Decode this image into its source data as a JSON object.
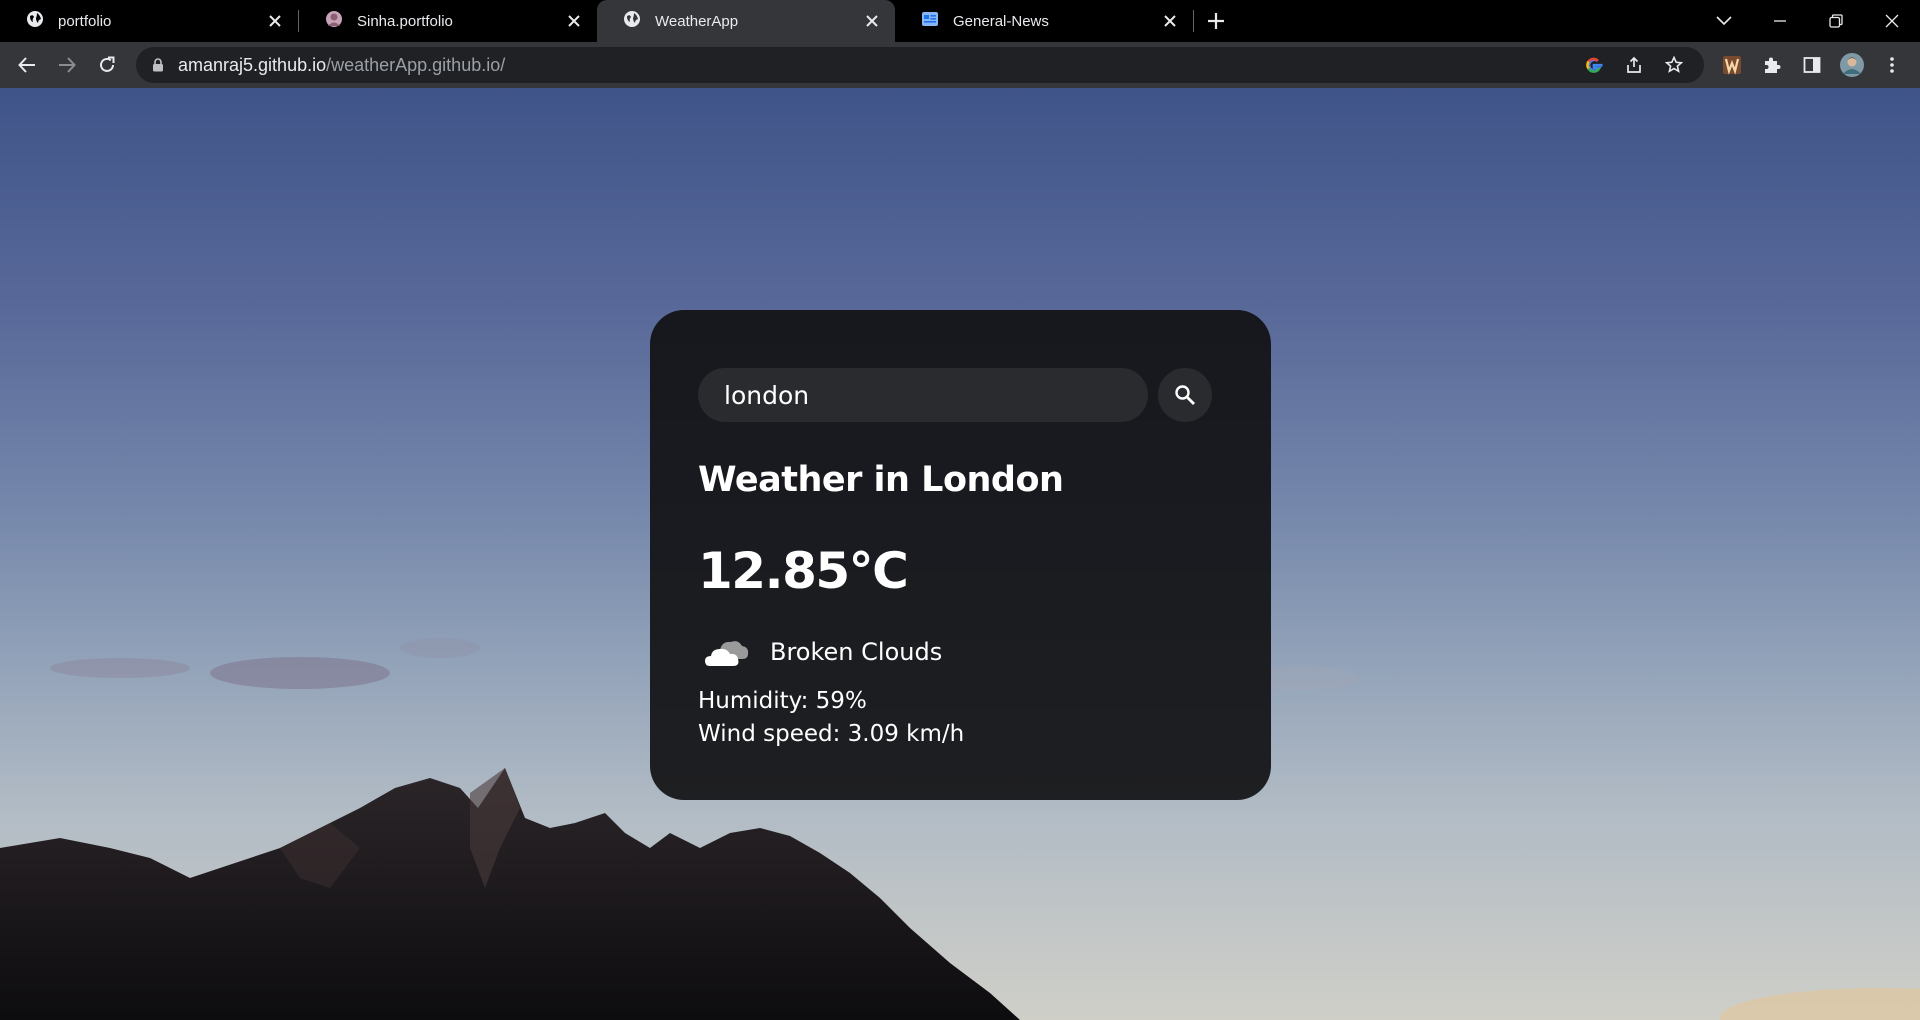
{
  "browser": {
    "tabs": [
      {
        "title": "portfolio",
        "icon": "globe-icon",
        "active": false
      },
      {
        "title": "Sinha.portfolio",
        "icon": "avatar-favicon",
        "active": false
      },
      {
        "title": "WeatherApp",
        "icon": "globe-icon",
        "active": true
      },
      {
        "title": "General-News",
        "icon": "news-icon",
        "active": false
      }
    ],
    "url_host": "amanraj5.github.io",
    "url_path": "/weatherApp.github.io/",
    "colors": {
      "tabstrip": "#000000",
      "toolbar": "#35363a",
      "omnibox": "#202124"
    }
  },
  "weather": {
    "search_value": "london",
    "search_placeholder": "Search",
    "city_title": "Weather in London",
    "temperature": "12.85°C",
    "description": "Broken Clouds",
    "weather_icon": "broken-clouds-icon",
    "humidity": "Humidity: 59%",
    "wind": "Wind speed: 3.09 km/h",
    "colors": {
      "card": "#111114",
      "input": "#2a2b2f",
      "text": "#ffffff"
    }
  }
}
